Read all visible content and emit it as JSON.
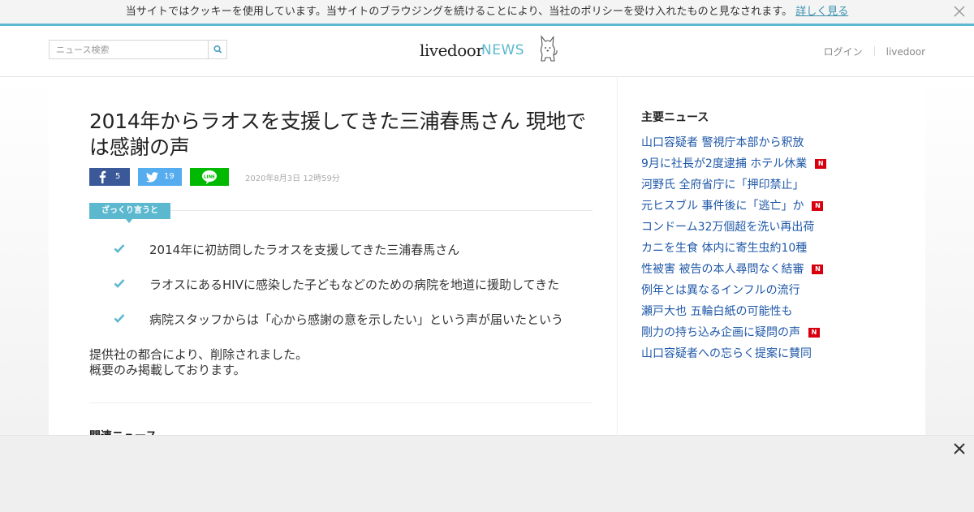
{
  "cookie_bar": {
    "text": "当サイトではクッキーを使用しています。当サイトのブラウジングを続けることにより、当社のポリシーを受け入れたものと見なされます。",
    "link": "詳しく見る",
    "close_icon": "close-icon"
  },
  "header": {
    "search_placeholder": "ニュース検索",
    "search_icon": "search-icon",
    "logo_livedoor": "livedoor",
    "logo_news": "NEWS",
    "links": [
      "ログイン",
      "livedoor"
    ]
  },
  "article": {
    "title": "2014年からラオスを支援してきた三浦春馬さん 現地では感謝の声",
    "share": {
      "facebook_count": "5",
      "twitter_count": "19"
    },
    "date": "2020年8月3日 12時59分",
    "summary_tag": "ざっくり言うと",
    "summary": [
      "2014年に初訪問したラオスを支援してきた三浦春馬さん",
      "ラオスにあるHIVに感染した子どもなどのための病院を地道に援助してきた",
      "病院スタッフからは「心から感謝の意を示したい」という声が届いたという"
    ],
    "body": [
      "提供社の都合により、削除されました。",
      "概要のみ掲載しております。"
    ],
    "related_heading": "関連ニュース"
  },
  "sidebar": {
    "heading": "主要ニュース",
    "items": [
      {
        "text": "山口容疑者 警視庁本部から釈放",
        "badge": ""
      },
      {
        "text": "9月に社長が2度逮捕 ホテル休業",
        "badge": "N"
      },
      {
        "text": "河野氏 全府省庁に「押印禁止」",
        "badge": ""
      },
      {
        "text": "元ヒスブル 事件後に「逃亡」か",
        "badge": "N"
      },
      {
        "text": "コンドーム32万個超を洗い再出荷",
        "badge": ""
      },
      {
        "text": "カニを生食 体内に寄生虫約10種",
        "badge": ""
      },
      {
        "text": "性被害 被告の本人尋問なく結審",
        "badge": "N"
      },
      {
        "text": "例年とは異なるインフルの流行",
        "badge": ""
      },
      {
        "text": "瀬戸大也 五輪白紙の可能性も",
        "badge": ""
      },
      {
        "text": "剛力の持ち込み企画に疑問の声",
        "badge": "N"
      },
      {
        "text": "山口容疑者への忘らく提案に賛同",
        "badge": ""
      }
    ]
  },
  "colors": {
    "accent": "#5bb8cf",
    "link": "#1f58a8",
    "badge": "#d8000f",
    "facebook": "#3b5998",
    "twitter": "#55acee",
    "line": "#00b900"
  }
}
